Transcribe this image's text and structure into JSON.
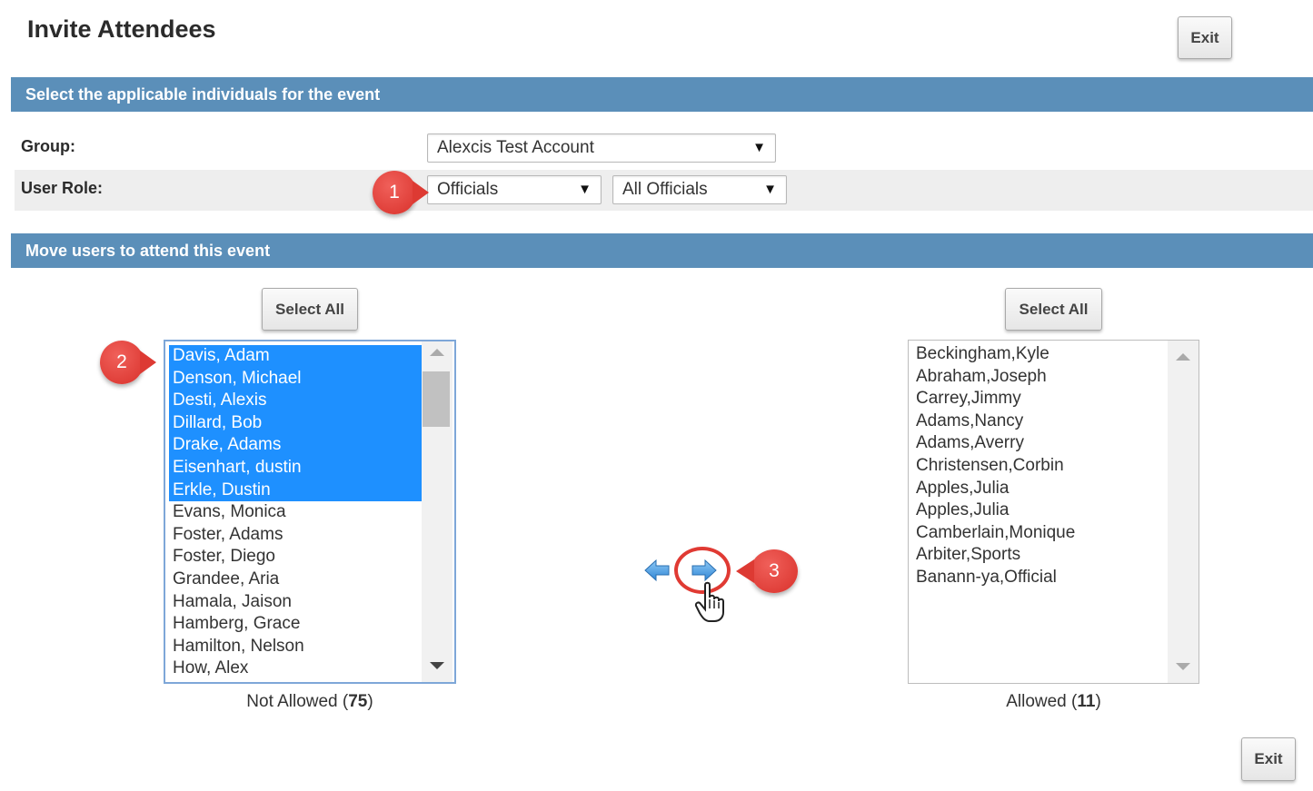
{
  "header": {
    "title": "Invite Attendees",
    "exit_top": "Exit"
  },
  "section1": {
    "heading": "Select the applicable individuals for the event"
  },
  "group": {
    "label": "Group:",
    "value": "Alexcis Test Account"
  },
  "user_role": {
    "label": "User Role:",
    "role_value": "Officials",
    "filter_value": "All Officials"
  },
  "section2": {
    "heading": "Move users to attend this event"
  },
  "left": {
    "select_all": "Select All",
    "items": [
      {
        "name": "Davis, Adam",
        "selected": true
      },
      {
        "name": "Denson, Michael",
        "selected": true
      },
      {
        "name": "Desti, Alexis",
        "selected": true
      },
      {
        "name": "Dillard, Bob",
        "selected": true
      },
      {
        "name": "Drake, Adams",
        "selected": true
      },
      {
        "name": "Eisenhart, dustin",
        "selected": true
      },
      {
        "name": "Erkle, Dustin",
        "selected": true
      },
      {
        "name": "Evans, Monica",
        "selected": false
      },
      {
        "name": "Foster, Adams",
        "selected": false
      },
      {
        "name": "Foster, Diego",
        "selected": false
      },
      {
        "name": "Grandee, Aria",
        "selected": false
      },
      {
        "name": "Hamala, Jaison",
        "selected": false
      },
      {
        "name": "Hamberg, Grace",
        "selected": false
      },
      {
        "name": "Hamilton, Nelson",
        "selected": false
      },
      {
        "name": "How, Alex",
        "selected": false
      }
    ],
    "caption_prefix": "Not Allowed (",
    "count": "75",
    "caption_suffix": ")"
  },
  "right": {
    "select_all": "Select All",
    "items": [
      "Beckingham,Kyle",
      "Abraham,Joseph",
      "Carrey,Jimmy",
      "Adams,Nancy",
      "Adams,Averry",
      "Christensen,Corbin",
      "Apples,Julia",
      "Apples,Julia",
      "Camberlain,Monique",
      "Arbiter,Sports",
      "Banann-ya,Official"
    ],
    "caption_prefix": "Allowed (",
    "count": "11",
    "caption_suffix": ")"
  },
  "callouts": {
    "one": "1",
    "two": "2",
    "three": "3"
  },
  "footer": {
    "exit_bottom": "Exit"
  },
  "icons": {
    "move_left": "arrow-left-icon",
    "move_right": "arrow-right-icon",
    "cursor": "hand-pointer-icon",
    "dropdown": "triangle-down-icon"
  },
  "colors": {
    "section_bar": "#5b8fb9",
    "selection": "#1e90ff",
    "callout": "#e03a33"
  }
}
